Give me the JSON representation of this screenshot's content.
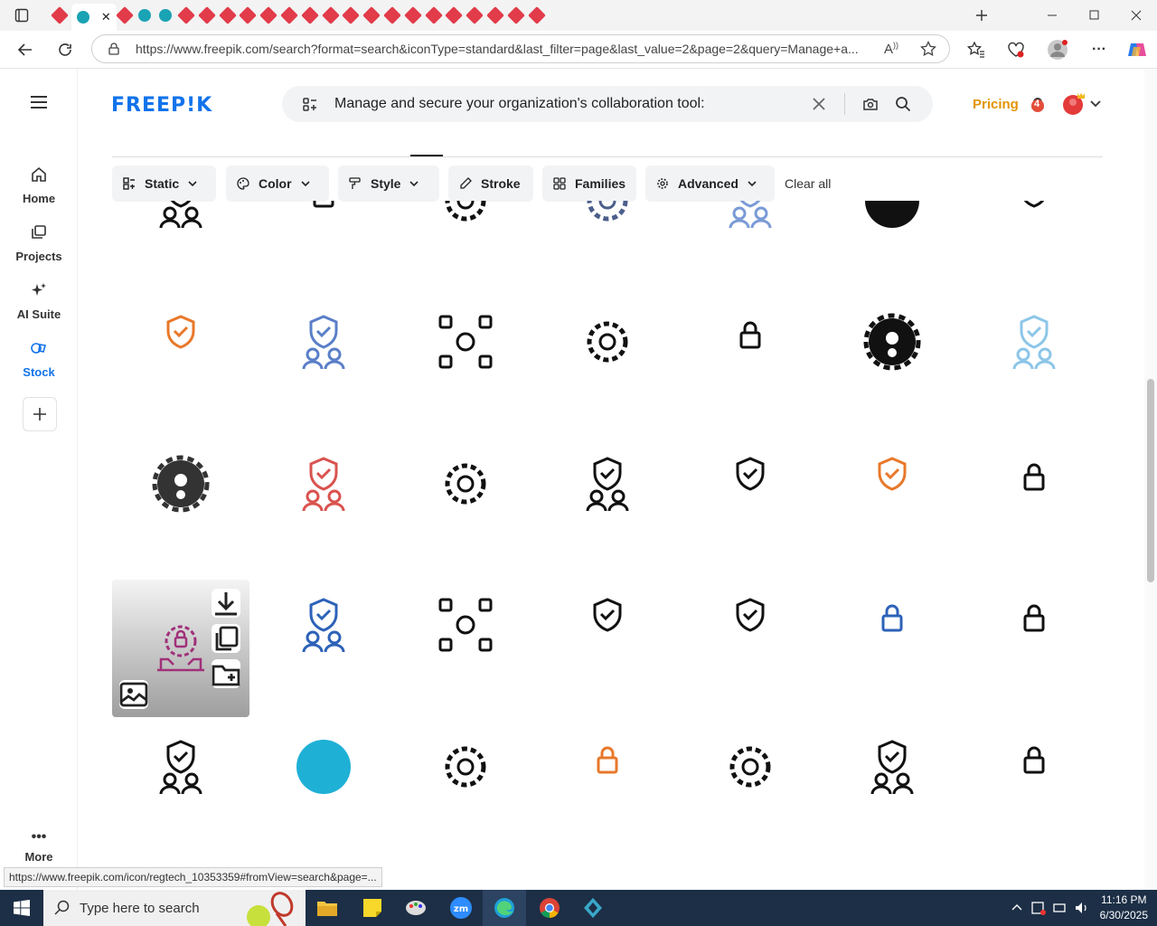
{
  "browser": {
    "url": "https://www.freepik.com/search?format=search&iconType=standard&last_filter=page&last_value=2&page=2&query=Manage+a...",
    "tab_count_visible": 23
  },
  "sidebar": {
    "items": [
      {
        "label": "Home",
        "icon": "home-icon"
      },
      {
        "label": "Projects",
        "icon": "projects-icon"
      },
      {
        "label": "AI Suite",
        "icon": "sparkle-icon"
      },
      {
        "label": "Stock",
        "icon": "stock-icon"
      }
    ],
    "more_label": "More"
  },
  "header": {
    "logo": "FREEP!K",
    "search_value": "Manage and secure your organization's collaboration tool:",
    "pricing": "Pricing",
    "notification_count": "4"
  },
  "filters": {
    "buttons": [
      {
        "label": "Static",
        "icon": "static-icon"
      },
      {
        "label": "Color",
        "icon": "palette-icon"
      },
      {
        "label": "Style",
        "icon": "brush-icon"
      },
      {
        "label": "Stroke",
        "icon": "pen-icon"
      },
      {
        "label": "Families",
        "icon": "grid-icon"
      },
      {
        "label": "Advanced",
        "icon": "gear-icon"
      }
    ],
    "clear_all": "Clear all"
  },
  "status_url": "https://www.freepik.com/icon/regtech_10353359#fromView=search&page=...",
  "taskbar": {
    "search_placeholder": "Type here to search",
    "time": "11:16 PM",
    "date": "6/30/2025"
  },
  "colors": {
    "brand_blue": "#1273eb",
    "pricing_orange": "#e29400",
    "taskbar": "#1d2f46"
  }
}
